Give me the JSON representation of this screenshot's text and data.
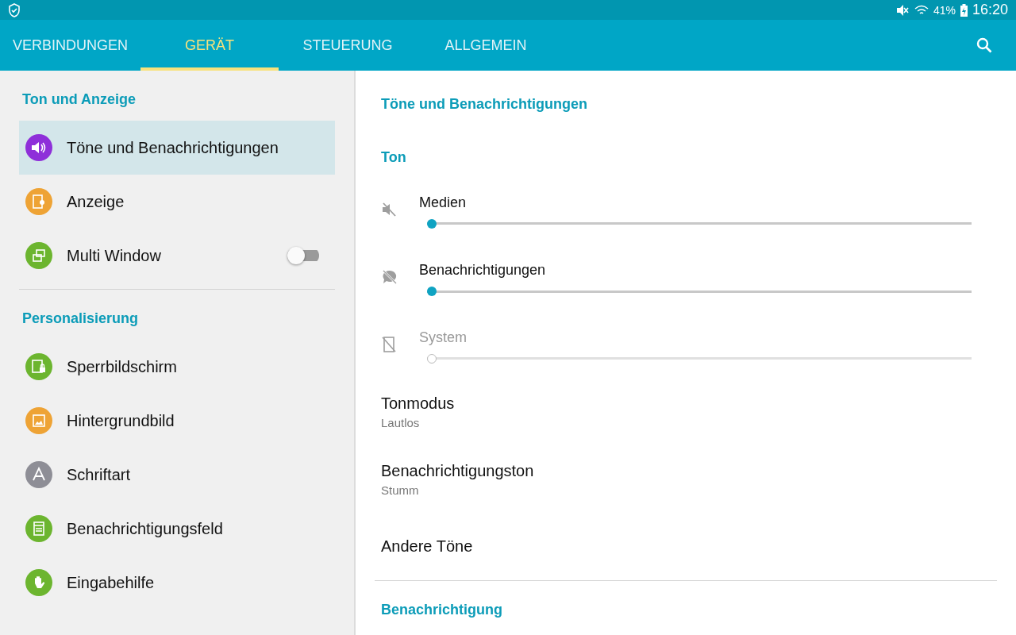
{
  "status_bar": {
    "battery": "41%",
    "time": "16:20"
  },
  "tabs": [
    {
      "label": "VERBINDUNGEN",
      "selected": false
    },
    {
      "label": "GERÄT",
      "selected": true
    },
    {
      "label": "STEUERUNG",
      "selected": false
    },
    {
      "label": "ALLGEMEIN",
      "selected": false
    }
  ],
  "sidebar": {
    "sections": [
      {
        "title": "Ton und Anzeige",
        "items": [
          {
            "label": "Töne und Benachrichtigungen",
            "color": "#8e2fd9",
            "selected": true
          },
          {
            "label": "Anzeige",
            "color": "#eea335",
            "selected": false
          },
          {
            "label": "Multi Window",
            "color": "#6cb52f",
            "selected": false,
            "kind": "toggle",
            "on": false
          }
        ]
      },
      {
        "title": "Personalisierung",
        "items": [
          {
            "label": "Sperrbildschirm",
            "color": "#6cb52f",
            "selected": false
          },
          {
            "label": "Hintergrundbild",
            "color": "#eea335",
            "selected": false
          },
          {
            "label": "Schriftart",
            "color": "#8e8e96",
            "selected": false
          },
          {
            "label": "Benachrichtigungsfeld",
            "color": "#6cb52f",
            "selected": false
          },
          {
            "label": "Eingabehilfe",
            "color": "#6cb52f",
            "selected": false
          }
        ]
      }
    ]
  },
  "detail": {
    "title": "Töne und Benachrichtigungen",
    "section": "Ton",
    "volumes": [
      {
        "label": "Medien",
        "level": 0,
        "disabled": false
      },
      {
        "label": "Benachrichtigungen",
        "level": 0,
        "disabled": false
      },
      {
        "label": "System",
        "level": 0,
        "disabled": true
      }
    ],
    "settings": [
      {
        "title": "Tonmodus",
        "value": "Lautlos"
      },
      {
        "title": "Benachrichtigungston",
        "value": "Stumm"
      },
      {
        "title": "Andere Töne"
      }
    ],
    "next_section": "Benachrichtigung"
  }
}
